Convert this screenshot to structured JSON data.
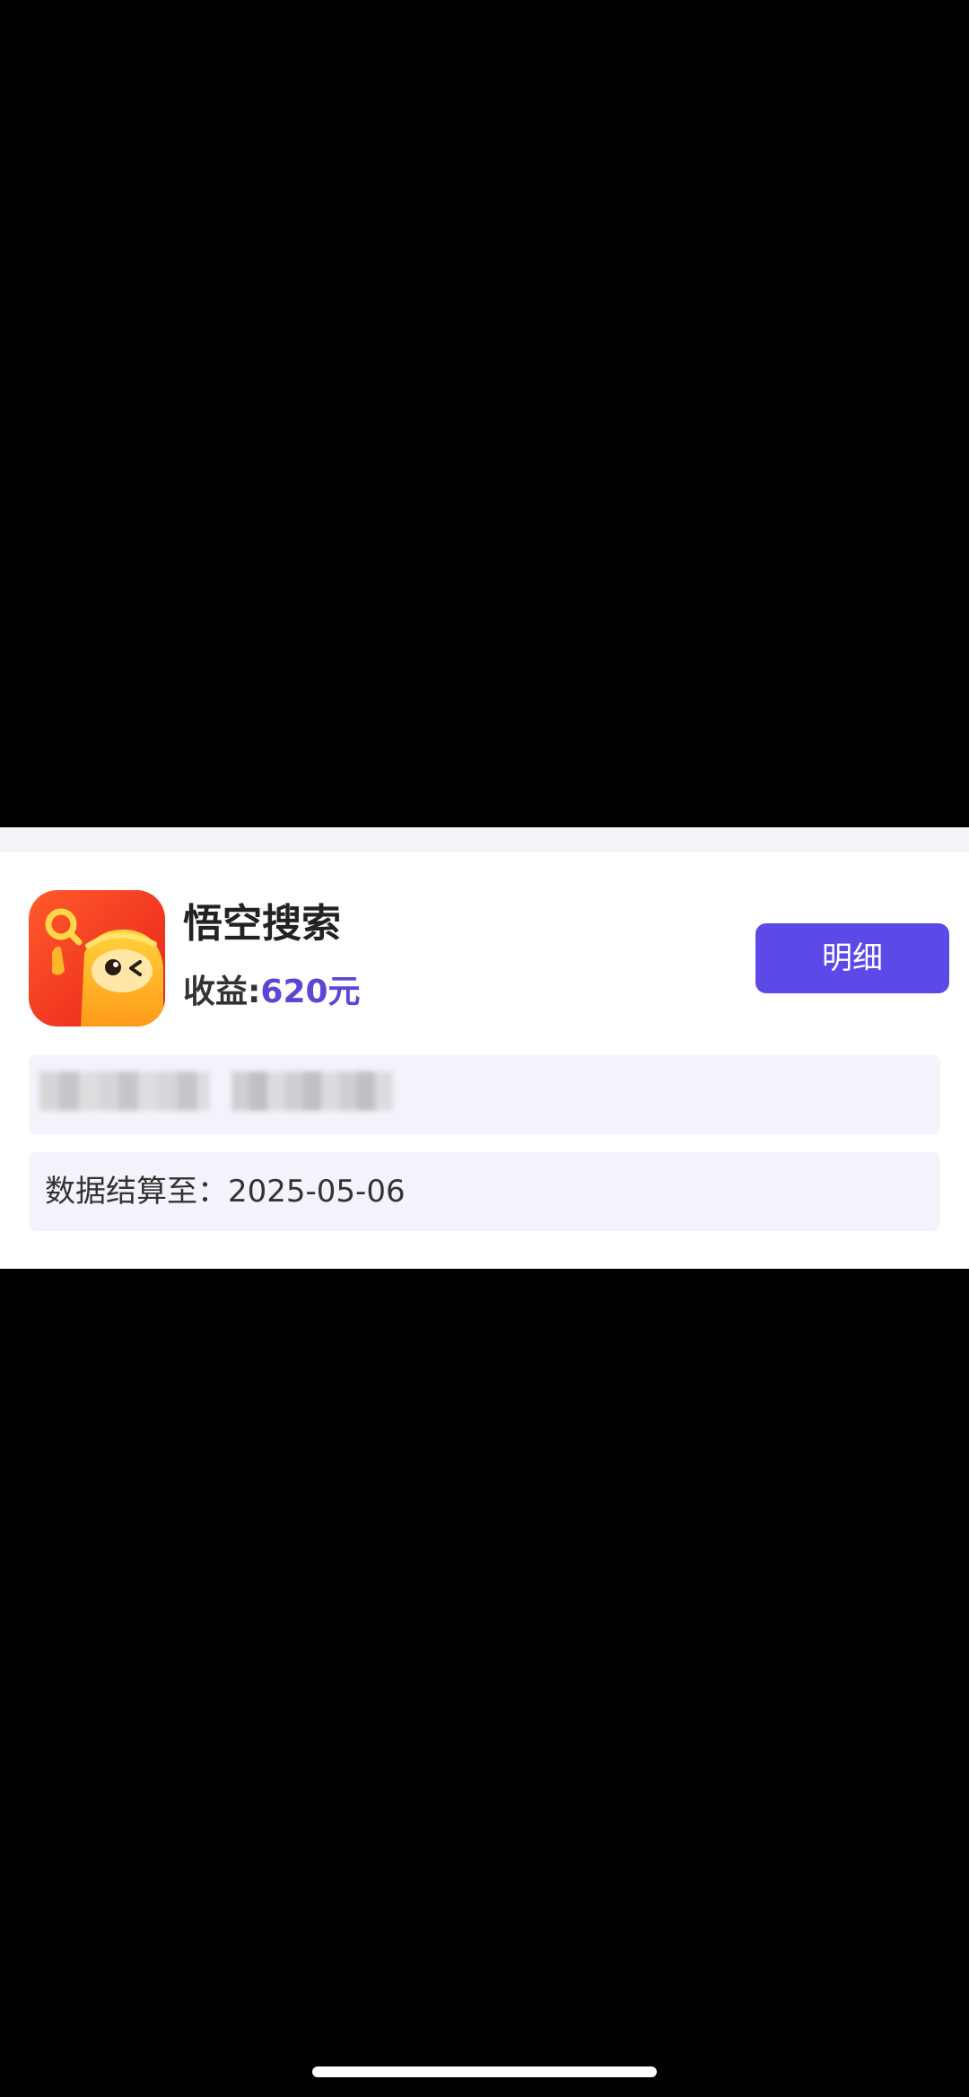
{
  "app": {
    "name": "悟空搜索",
    "icon": "wukong-search-app-icon",
    "earnings_label": "收益:",
    "earnings_value": "620元",
    "accent_color": "#5b47d6"
  },
  "detail_button": {
    "label": "明细",
    "color": "#5c4ae8"
  },
  "settlement": {
    "text": "数据结算至：2025-05-06"
  }
}
